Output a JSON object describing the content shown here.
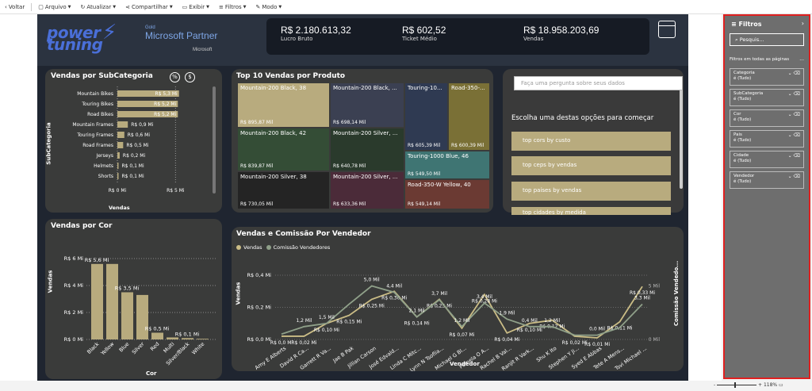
{
  "toolbar": {
    "back": "Voltar",
    "items": [
      "Arquivo",
      "Atualizar",
      "Compartilhar",
      "Exibir",
      "Filtros",
      "Modo"
    ]
  },
  "header": {
    "logo_line1": "power",
    "logo_line2": "tuning",
    "partner_gold": "Gold",
    "partner_name": "Microsoft Partner",
    "partner_ms": "Microsoft",
    "kpis": [
      {
        "value": "R$ 2.180.613,32",
        "label": "Lucro Bruto"
      },
      {
        "value": "R$ 602,52",
        "label": "Ticket Médio"
      },
      {
        "value": "R$ 18.958.203,69",
        "label": "Vendas"
      }
    ]
  },
  "subcat": {
    "title": "Vendas por SubCategoria",
    "ylabel": "SubCategoria",
    "xlabel": "Vendas",
    "xticks": [
      "R$ 0 Mi",
      "R$ 5 Mi"
    ],
    "toggle_pct": "%",
    "toggle_cur": "$"
  },
  "color_chart": {
    "title": "Vendas por Cor",
    "ylabel": "Vendas",
    "xlabel": "Cor",
    "yticks": [
      "R$ 6 Mi",
      "R$ 4 Mi",
      "R$ 2 Mi",
      "R$ 0 Mi"
    ]
  },
  "treemap": {
    "title": "Top 10 Vendas por Produto",
    "cells": [
      {
        "name": "Mountain-200 Black, 38",
        "value": "R$ 895,87 Mil"
      },
      {
        "name": "Mountain-200 Black, ...",
        "value": "R$ 698,14 Mil"
      },
      {
        "name": "Touring-10...",
        "value": "R$ 605,39 Mil"
      },
      {
        "name": "Road-350-...",
        "value": "R$ 600,39 Mil"
      },
      {
        "name": "Mountain-200 Black, 42",
        "value": "R$ 839,87 Mil"
      },
      {
        "name": "Mountain-200 Silver, ...",
        "value": "R$ 640,78 Mil"
      },
      {
        "name": "Touring-1000 Blue, 46",
        "value": "R$ 549,50 Mil"
      },
      {
        "name": "Mountain-200 Silver, 38",
        "value": "R$ 730,05 Mil"
      },
      {
        "name": "Mountain-200 Silver, ...",
        "value": "R$ 633,36 Mil"
      },
      {
        "name": "Road-350-W Yellow, 40",
        "value": "R$ 549,14 Mil"
      }
    ]
  },
  "qa": {
    "placeholder": "Faça uma pergunta sobre seus dados",
    "heading": "Escolha uma destas opções para começar",
    "options": [
      "top cors by custo",
      "top ceps by vendas",
      "top países by vendas",
      "top cidades by medida"
    ]
  },
  "vendedor": {
    "title": "Vendas e Comissão Por Vendedor",
    "legend": [
      "Vendas",
      "Comissão Vendedores"
    ],
    "xlabel": "Vendedor",
    "ylabel": "Vendas",
    "y2label": "Comissão Vendedo...",
    "yticks": [
      "R$ 0,4 Mi",
      "R$ 0,2 Mi",
      "R$ 0,0 Mi"
    ],
    "y2ticks": [
      "5 Mil",
      "0 Mil"
    ]
  },
  "filters": {
    "title": "Filtros",
    "search_placeholder": "Pesquis...",
    "subtitle": "Filtros em todas as páginas",
    "more": "...",
    "cards": [
      {
        "name": "Categoria",
        "state": "é (Tudo)"
      },
      {
        "name": "SubCategoria",
        "state": "é (Tudo)"
      },
      {
        "name": "Cor",
        "state": "é (Tudo)"
      },
      {
        "name": "Pais",
        "state": "é (Tudo)"
      },
      {
        "name": "Cidade",
        "state": "é (Tudo)"
      },
      {
        "name": "Vendedor",
        "state": "é (Tudo)"
      }
    ]
  },
  "status": {
    "zoom": "118%"
  },
  "colors": {
    "bar": "#b8ab7e",
    "line1": "#cbbd86",
    "line2": "#8fa089",
    "filter_border": "#e02020"
  },
  "chart_data": [
    {
      "type": "bar",
      "orientation": "horizontal",
      "title": "Vendas por SubCategoria",
      "categories": [
        "Mountain Bikes",
        "Touring Bikes",
        "Road Bikes",
        "Mountain Frames",
        "Touring Frames",
        "Road Frames",
        "Jerseys",
        "Helmets",
        "Shorts"
      ],
      "values": [
        5.3,
        5.2,
        5.2,
        0.9,
        0.6,
        0.5,
        0.2,
        0.1,
        0.1
      ],
      "labels": [
        "R$ 5,3 Mi",
        "R$ 5,2 Mi",
        "R$ 5,2 Mi",
        "R$ 0,9 Mi",
        "R$ 0,6 Mi",
        "R$ 0,5 Mi",
        "R$ 0,2 Mi",
        "R$ 0,1 Mi",
        "R$ 0,1 Mi"
      ],
      "xlabel": "Vendas",
      "ylabel": "SubCategoria",
      "xlim": [
        0,
        6
      ]
    },
    {
      "type": "bar",
      "title": "Vendas por Cor",
      "categories": [
        "Black",
        "Yellow",
        "Blue",
        "Silver",
        "Red",
        "Multi",
        "Silver/Black",
        "White"
      ],
      "values": [
        5.6,
        5.6,
        3.5,
        3.3,
        0.5,
        0.15,
        0.1,
        0.05
      ],
      "labels": [
        "R$ 5,6 Mi",
        "",
        "R$ 3,5 Mi",
        "",
        "R$ 0,5 Mi",
        "",
        "R$ 0,1 Mi",
        ""
      ],
      "xlabel": "Cor",
      "ylabel": "Vendas",
      "ylim": [
        0,
        6
      ]
    },
    {
      "type": "line",
      "title": "Vendas e Comissão Por Vendedor",
      "categories": [
        "Amy E Alberts",
        "David R Ca...",
        "Garrett R Va...",
        "Jae B Pak",
        "Jillian Carson",
        "José Edvald...",
        "Linda C Mitc...",
        "Lynn N Tsoflia...",
        "Michael G Bl...",
        "Pamela O A...",
        "Rachel B Val...",
        "Ranjit R Vark...",
        "Shu K Ito",
        "Stephen Y Ji...",
        "Syed E Abbas",
        "Tete A Mens...",
        "Tsvi Michael ..."
      ],
      "series": [
        {
          "name": "Vendas",
          "values": [
            0.02,
            0.02,
            0.1,
            0.15,
            0.25,
            0.3,
            0.14,
            0.25,
            0.07,
            0.28,
            0.04,
            0.1,
            0.12,
            0.02,
            0.01,
            0.11,
            0.33
          ],
          "labels": [
            "R$ 0,0 Mi",
            "R$ 0,02 Mi",
            "R$ 0,10 Mi",
            "R$ 0,15 Mi",
            "R$ 0,25 Mi",
            "R$ 0,30 Mi",
            "R$ 0,14 Mi",
            "R$ 0,25 Mi",
            "R$ 0,07 Mi",
            "R$ 0,28 Mi",
            "R$ 0,04 Mi",
            "R$ 0,10 Mi",
            "R$ 0,12 Mi",
            "R$ 0,02 Mi",
            "R$ 0,01 Mi",
            "R$ 0,11 Mi",
            "R$ 0,33 Mi"
          ]
        },
        {
          "name": "Comissão Vendedores",
          "values": [
            0.5,
            1.2,
            1.5,
            3.3,
            5.0,
            4.4,
            2.1,
            3.7,
            1.2,
            3.4,
            1.9,
            1.2,
            1.2,
            0.4,
            0.4,
            1.1,
            3.3
          ],
          "labels": [
            "",
            "1,2 Mil",
            "1,5 Mil",
            "",
            "5,0 Mil",
            "4,4 Mil",
            "2,1 Mil",
            "3,7 Mil",
            "1,2 Mil",
            "3,4 Mil",
            "1,9 Mil",
            "0,4 Mil",
            "1,2 Mil",
            "",
            "0,0 Mil",
            "",
            "3,3 Mil"
          ]
        }
      ],
      "xlabel": "Vendedor",
      "ylabel": "Vendas",
      "y2label": "Comissão Vendedo...",
      "ylim": [
        0,
        0.4
      ],
      "y2lim": [
        0,
        6
      ]
    }
  ]
}
